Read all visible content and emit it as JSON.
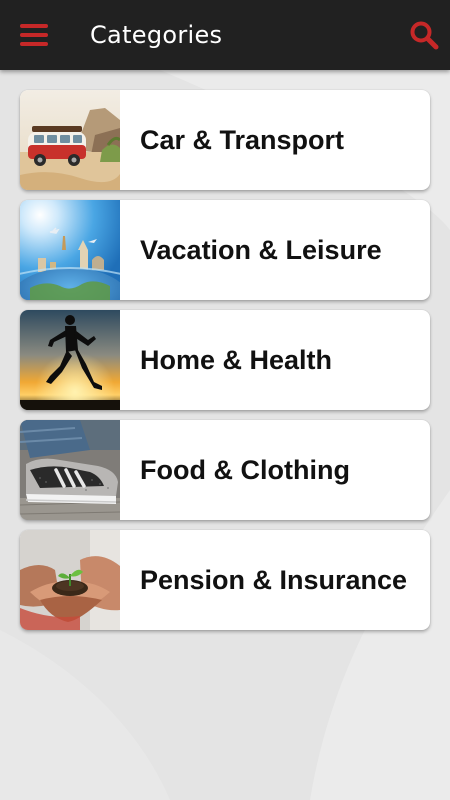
{
  "appbar": {
    "title": "Categories",
    "background": "#212121",
    "accent": "#c62828",
    "menu_icon": "hamburger-menu-icon",
    "search_icon": "search-icon"
  },
  "categories": [
    {
      "label": "Car & Transport",
      "image": "vintage van on beach"
    },
    {
      "label": "Vacation & Leisure",
      "image": "globe with world landmarks and airplanes"
    },
    {
      "label": "Home & Health",
      "image": "runner silhouette at sunset"
    },
    {
      "label": "Food & Clothing",
      "image": "sneaker close-up"
    },
    {
      "label": "Pension & Insurance",
      "image": "hands holding seedling"
    }
  ]
}
